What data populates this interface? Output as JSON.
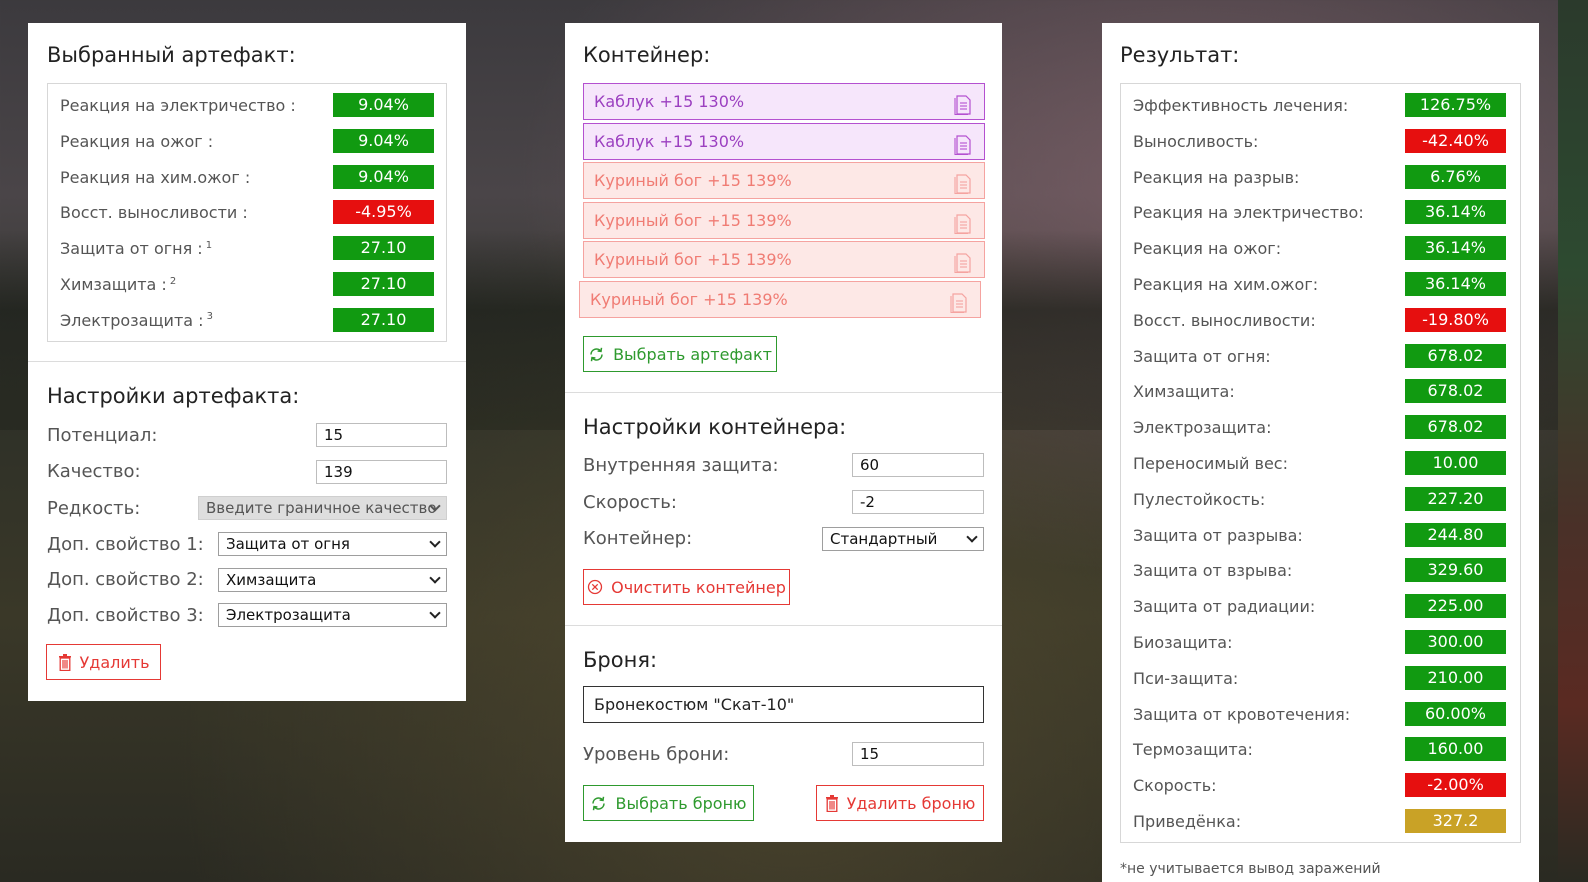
{
  "selected_artifact": {
    "title": "Выбранный артефакт:",
    "stats": [
      {
        "label": "Реакция на электричество :",
        "value": "9.04%",
        "color": "green",
        "sup": ""
      },
      {
        "label": "Реакция на ожог :",
        "value": "9.04%",
        "color": "green",
        "sup": ""
      },
      {
        "label": "Реакция на хим.ожог :",
        "value": "9.04%",
        "color": "green",
        "sup": ""
      },
      {
        "label": "Восст. выносливости :",
        "value": "-4.95%",
        "color": "red",
        "sup": ""
      },
      {
        "label": "Защита от огня :",
        "value": "27.10",
        "color": "green",
        "sup": "1"
      },
      {
        "label": "Химзащита :",
        "value": "27.10",
        "color": "green",
        "sup": "2"
      },
      {
        "label": "Электрозащита :",
        "value": "27.10",
        "color": "green",
        "sup": "3"
      }
    ]
  },
  "artifact_settings": {
    "title": "Настройки артефакта:",
    "potential_label": "Потенциал:",
    "potential_value": "15",
    "quality_label": "Качество:",
    "quality_value": "139",
    "rarity_label": "Редкость:",
    "rarity_value": "Введите граничное качество",
    "extra1_label": "Доп. свойство 1:",
    "extra1_value": "Защита от огня",
    "extra2_label": "Доп. свойство 2:",
    "extra2_value": "Химзащита",
    "extra3_label": "Доп. свойство 3:",
    "extra3_value": "Электрозащита",
    "delete_label": "Удалить"
  },
  "container": {
    "title": "Контейнер:",
    "slots": [
      {
        "label": "Каблук +15 130%",
        "style": "purple"
      },
      {
        "label": "Каблук +15 130%",
        "style": "purple"
      },
      {
        "label": "Куриный бог +15 139%",
        "style": "pink"
      },
      {
        "label": "Куриный бог +15 139%",
        "style": "pink"
      },
      {
        "label": "Куриный бог +15 139%",
        "style": "pink"
      },
      {
        "label": "Куриный бог +15 139%",
        "style": "pink"
      }
    ],
    "select_artifact_label": "Выбрать артефакт"
  },
  "container_settings": {
    "title": "Настройки контейнера:",
    "inner_protection_label": "Внутренняя защита:",
    "inner_protection_value": "60",
    "speed_label": "Скорость:",
    "speed_value": "-2",
    "container_label": "Контейнер:",
    "container_value": "Стандартный",
    "clear_label": "Очистить контейнер"
  },
  "armor": {
    "title": "Броня:",
    "name": "Бронекостюм \"Скат-10\"",
    "level_label": "Уровень брони:",
    "level_value": "15",
    "select_label": "Выбрать броню",
    "delete_label": "Удалить броню"
  },
  "result": {
    "title": "Результат:",
    "stats": [
      {
        "label": "Эффективность лечения:",
        "value": "126.75%",
        "color": "green"
      },
      {
        "label": "Выносливость:",
        "value": "-42.40%",
        "color": "red"
      },
      {
        "label": "Реакция на разрыв:",
        "value": "6.76%",
        "color": "green"
      },
      {
        "label": "Реакция на электричество:",
        "value": "36.14%",
        "color": "green"
      },
      {
        "label": "Реакция на ожог:",
        "value": "36.14%",
        "color": "green"
      },
      {
        "label": "Реакция на хим.ожог:",
        "value": "36.14%",
        "color": "green"
      },
      {
        "label": "Восст. выносливости:",
        "value": "-19.80%",
        "color": "red"
      },
      {
        "label": "Защита от огня:",
        "value": "678.02",
        "color": "green"
      },
      {
        "label": "Химзащита:",
        "value": "678.02",
        "color": "green"
      },
      {
        "label": "Электрозащита:",
        "value": "678.02",
        "color": "green"
      },
      {
        "label": "Переносимый вес:",
        "value": "10.00",
        "color": "green"
      },
      {
        "label": "Пулестойкость:",
        "value": "227.20",
        "color": "green"
      },
      {
        "label": "Защита от разрыва:",
        "value": "244.80",
        "color": "green"
      },
      {
        "label": "Защита от взрыва:",
        "value": "329.60",
        "color": "green"
      },
      {
        "label": "Защита от радиации:",
        "value": "225.00",
        "color": "green"
      },
      {
        "label": "Биозащита:",
        "value": "300.00",
        "color": "green"
      },
      {
        "label": "Пси-защита:",
        "value": "210.00",
        "color": "green"
      },
      {
        "label": "Защита от кровотечения:",
        "value": "60.00%",
        "color": "green"
      },
      {
        "label": "Термозащита:",
        "value": "160.00",
        "color": "green"
      },
      {
        "label": "Скорость:",
        "value": "-2.00%",
        "color": "red"
      },
      {
        "label": "Приведёнка:",
        "value": "327.2",
        "color": "gold"
      }
    ],
    "footnote": "*не учитывается вывод заражений"
  },
  "colors": {
    "green": "#119a11",
    "red": "#e60f0f",
    "gold": "#c9a226",
    "slot_purple_border": "#b450d0",
    "slot_pink_border": "#f5a3a0"
  }
}
